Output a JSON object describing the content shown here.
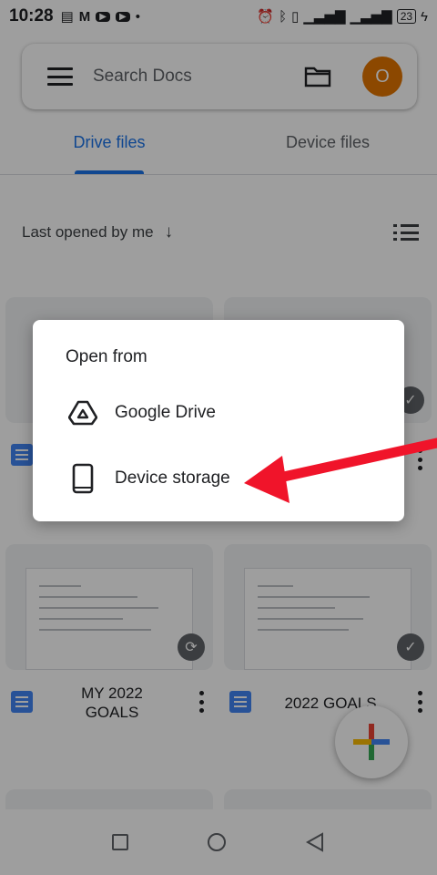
{
  "status_bar": {
    "time": "10:28",
    "battery": "23",
    "left_icons": [
      "document-icon",
      "gmail-icon",
      "youtube-icon",
      "youtube-icon",
      "dot-icon"
    ],
    "right_icons": [
      "alarm-icon",
      "bluetooth-icon",
      "vibrate-icon",
      "signal-icon",
      "signal-icon",
      "battery-icon",
      "charging-icon"
    ]
  },
  "search": {
    "placeholder": "Search Docs",
    "avatar_letter": "O",
    "avatar_color": "#e37400"
  },
  "tabs": [
    {
      "label": "Drive files",
      "active": true
    },
    {
      "label": "Device files",
      "active": false
    }
  ],
  "sort": {
    "label": "Last opened by me",
    "direction": "↓"
  },
  "documents": [
    {
      "title": "MY 2022\nGOALS"
    },
    {
      "title": "2022 GOALS"
    }
  ],
  "dialog": {
    "title": "Open from",
    "options": [
      {
        "label": "Google Drive",
        "icon": "google-drive-icon"
      },
      {
        "label": "Device storage",
        "icon": "phone-icon"
      }
    ]
  },
  "colors": {
    "accent": "#1a73e8",
    "annotation_arrow": "#f0142a"
  }
}
